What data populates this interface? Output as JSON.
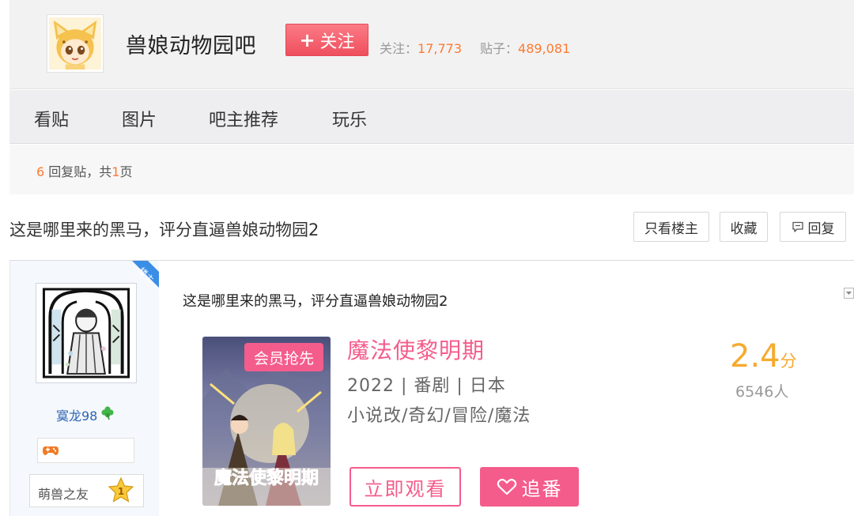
{
  "forum": {
    "name": "兽娘动物园吧",
    "follow_label": "关注",
    "followers_label": "关注：",
    "followers_count": "17,773",
    "posts_label": "贴子：",
    "posts_count": "489,081"
  },
  "nav": {
    "tabs": [
      "看贴",
      "图片",
      "吧主推荐",
      "玩乐"
    ]
  },
  "reply_bar": {
    "count": "6",
    "text_mid": " 回复贴，共",
    "pages": "1",
    "text_end": "页"
  },
  "thread": {
    "title": "这是哪里来的黑马，评分直逼兽娘动物园2",
    "buttons": {
      "only_op": "只看楼主",
      "collect": "收藏",
      "reply": "回复"
    }
  },
  "post": {
    "op_ribbon": "楼主",
    "username": "寞龙98",
    "level_name": "萌兽之友",
    "level": "1",
    "content": "这是哪里来的黑马，评分直逼兽娘动物园2"
  },
  "anime_card": {
    "poster_tag": "会员抢先",
    "poster_title_art": "魔法使黎明期",
    "title": "魔法使黎明期",
    "meta": "2022 | 番剧 | 日本",
    "tags": "小说改/奇幻/冒险/魔法",
    "score": "2.4",
    "score_unit": "分",
    "rating_count": "6546人",
    "watch_label": "立即观看",
    "follow_label": "追番"
  },
  "colors": {
    "accent_orange": "#ff7a2f",
    "follow_red": "#ef4f5d",
    "anime_pink": "#f45c8c",
    "score_gold": "#f6aa2d",
    "link_blue": "#2d64b3"
  }
}
